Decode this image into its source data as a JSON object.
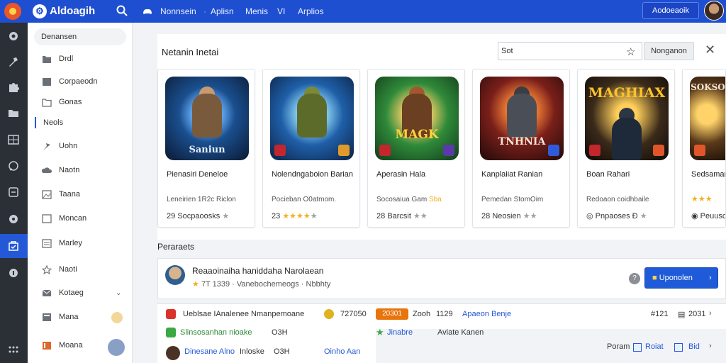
{
  "topbar": {
    "brand": "Aldoagih",
    "nav": [
      "Nonnsein",
      "Aplisn",
      "Menis",
      "VI",
      "Arplios"
    ],
    "separator": "·",
    "action_button": "Aodoeaoik"
  },
  "sidebar": {
    "search_value": "Denansen",
    "items": [
      {
        "label": "Drdl"
      },
      {
        "label": "Corpaeodn"
      },
      {
        "label": "Gonas"
      },
      {
        "label": "Neols"
      },
      {
        "label": "Uohn"
      },
      {
        "label": "Naotn"
      },
      {
        "label": "Taana"
      },
      {
        "label": "Moncan"
      },
      {
        "label": "Marley"
      },
      {
        "label": "Naoti"
      },
      {
        "label": "Kotaeg",
        "chevron": "⌄"
      },
      {
        "label": "Mana"
      },
      {
        "label": "Moana"
      }
    ]
  },
  "main": {
    "section_title": "Netanin Inetai",
    "search": {
      "value": "Sot",
      "button": "Nonganon",
      "close": "✕"
    },
    "cards": [
      {
        "title": "Pienasiri Deneloe",
        "meta": "Leneirien 1R2c Riclon",
        "rating_text": "29",
        "rating_suffix": "Socpaoosks",
        "stars_on": 0,
        "stars_off": 1,
        "art_text": "Saniun"
      },
      {
        "title": "Nolendngaboion Barian",
        "meta": "Pocieban O0atmom.",
        "rating_text": "23",
        "rating_suffix": "",
        "stars_on": 4,
        "stars_off": 1,
        "art_text": ""
      },
      {
        "title": "Aperasin Hala",
        "meta": "Socosaiua Gam",
        "meta_highlight": "Sba",
        "rating_text": "28",
        "rating_suffix": "Barcsit",
        "stars_on": 0,
        "stars_off": 2,
        "art_text": "MAGK"
      },
      {
        "title": "Kanplaiiat Ranian",
        "meta": "Pemedan StomOim",
        "rating_text": "28",
        "rating_suffix": "Neosien",
        "stars_on": 0,
        "stars_off": 2,
        "art_text": "TNHNIA"
      },
      {
        "title": "Boan Rahari",
        "meta": "Redoaon coidhbaile",
        "rating_text": "Pnpaoses",
        "rating_prefix": "◎",
        "rating_suffix": "Ð",
        "stars_on": 0,
        "stars_off": 1,
        "art_text": "MAGHIAX"
      },
      {
        "title": "Sedsaman",
        "meta": "",
        "rating_text": "Peuusc",
        "rating_prefix": "◉",
        "rating_suffix": "",
        "stars_on": 3,
        "stars_off": 0,
        "art_text": "SOKSOE"
      }
    ],
    "section2_title": "Peraraets",
    "featured": {
      "title": "Reaaoinaiha haniddaha Narolaean",
      "meta_num": "7T 1339",
      "meta_rest": "Vanebochemeogs · Nbbhty",
      "help": "?",
      "button": "Uponolen"
    },
    "list": {
      "r1": {
        "text": "Ueblsae IAnalenee Nmanpemoane",
        "value": "727050",
        "chip": "20301",
        "col2a": "Zooh",
        "col2b": "1129",
        "link": "Apaeon Benje",
        "num": "#121",
        "end": "2031"
      },
      "r2": {
        "text": "Slinsosanhan nioake",
        "value": "O3H",
        "col2a": "Jinabre",
        "col2b": "Aviate Kanen"
      },
      "r3": {
        "text": "Dinesane Alno",
        "mid": "Inloske",
        "value": "O3H",
        "link": "Oinho Aan",
        "end_label": "Poram",
        "act1": "Roiat",
        "act2": "Bid"
      }
    }
  },
  "colors": {
    "topbar": "#1f4fd1",
    "rail": "#2b2f36",
    "accent": "#2458d6",
    "star": "#f2b01e",
    "chip": "#e8740c"
  }
}
